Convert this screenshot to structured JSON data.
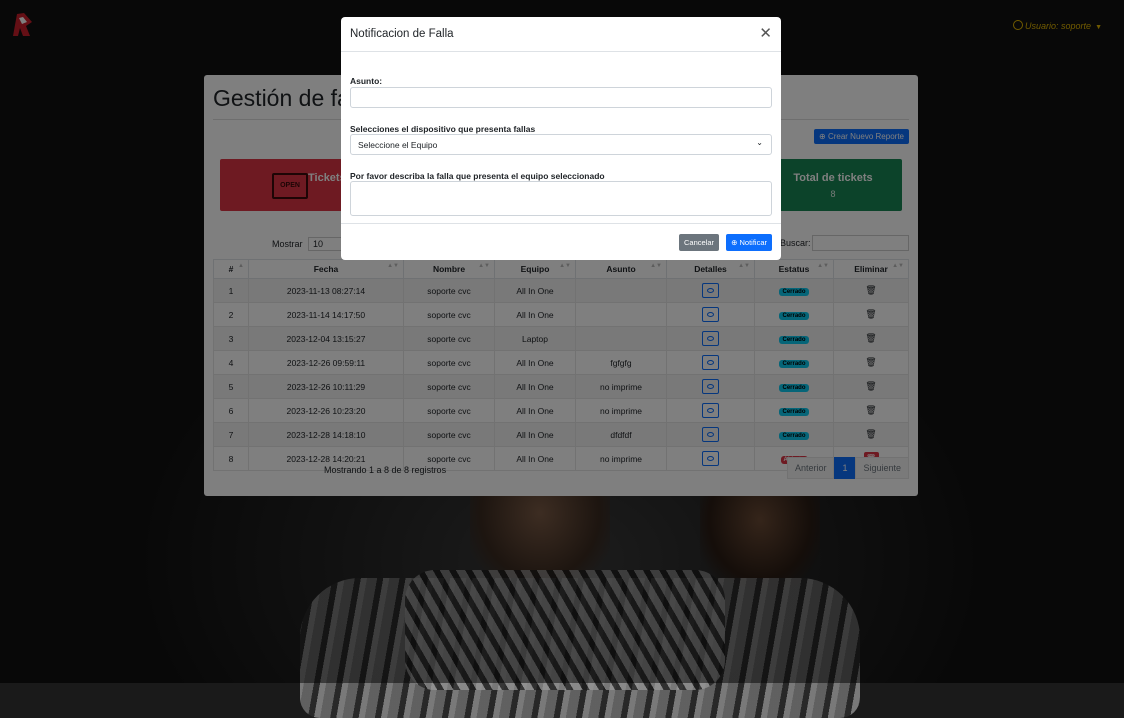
{
  "header": {
    "user_label": "Usuario: soporte"
  },
  "page": {
    "title": "Gestión de fallas",
    "create_button": "Crear Nuevo Reporte"
  },
  "tiles": [
    {
      "title": "Tickets",
      "value": ""
    },
    {
      "title": "Total de tickets",
      "value": "8"
    }
  ],
  "table_controls": {
    "show_label": "Mostrar",
    "page_length": "10",
    "search_label": "Buscar:"
  },
  "table": {
    "headers": [
      "#",
      "Fecha",
      "Nombre",
      "Equipo",
      "Asunto",
      "Detalles",
      "Estatus",
      "Eliminar"
    ],
    "rows": [
      {
        "n": "1",
        "fecha": "2023-11-13 08:27:14",
        "nombre": "soporte cvc",
        "equipo": "All In One",
        "asunto": "",
        "estatus": "Cerrado"
      },
      {
        "n": "2",
        "fecha": "2023-11-14 14:17:50",
        "nombre": "soporte cvc",
        "equipo": "All In One",
        "asunto": "",
        "estatus": "Cerrado"
      },
      {
        "n": "3",
        "fecha": "2023-12-04 13:15:27",
        "nombre": "soporte cvc",
        "equipo": "Laptop",
        "asunto": "",
        "estatus": "Cerrado"
      },
      {
        "n": "4",
        "fecha": "2023-12-26 09:59:11",
        "nombre": "soporte cvc",
        "equipo": "All In One",
        "asunto": "fgfgfg",
        "estatus": "Cerrado"
      },
      {
        "n": "5",
        "fecha": "2023-12-26 10:11:29",
        "nombre": "soporte cvc",
        "equipo": "All In One",
        "asunto": "no imprime",
        "estatus": "Cerrado"
      },
      {
        "n": "6",
        "fecha": "2023-12-26 10:23:20",
        "nombre": "soporte cvc",
        "equipo": "All In One",
        "asunto": "no imprime",
        "estatus": "Cerrado"
      },
      {
        "n": "7",
        "fecha": "2023-12-28 14:18:10",
        "nombre": "soporte cvc",
        "equipo": "All In One",
        "asunto": "dfdfdf",
        "estatus": "Cerrado"
      },
      {
        "n": "8",
        "fecha": "2023-12-28 14:20:21",
        "nombre": "soporte cvc",
        "equipo": "All In One",
        "asunto": "no imprime",
        "estatus": "Abierto"
      }
    ]
  },
  "footer": {
    "info": "Mostrando 1 a 8 de 8 registros",
    "prev": "Anterior",
    "page": "1",
    "next": "Siguiente"
  },
  "modal": {
    "title": "Notificacion de Falla",
    "subject_label": "Asunto:",
    "subject_value": "",
    "device_label": "Selecciones el dispositivo que presenta fallas",
    "device_selected": "Seleccione el Equipo",
    "description_label": "Por favor describa la falla que presenta el equipo seleccionado",
    "description_value": "",
    "cancel_button": "Cancelar",
    "notify_button": "Notificar"
  },
  "colors": {
    "primary": "#0d6efd",
    "danger": "#dc3545",
    "success": "#198754",
    "info": "#0dcaf0",
    "user_accent": "#e0b400"
  }
}
